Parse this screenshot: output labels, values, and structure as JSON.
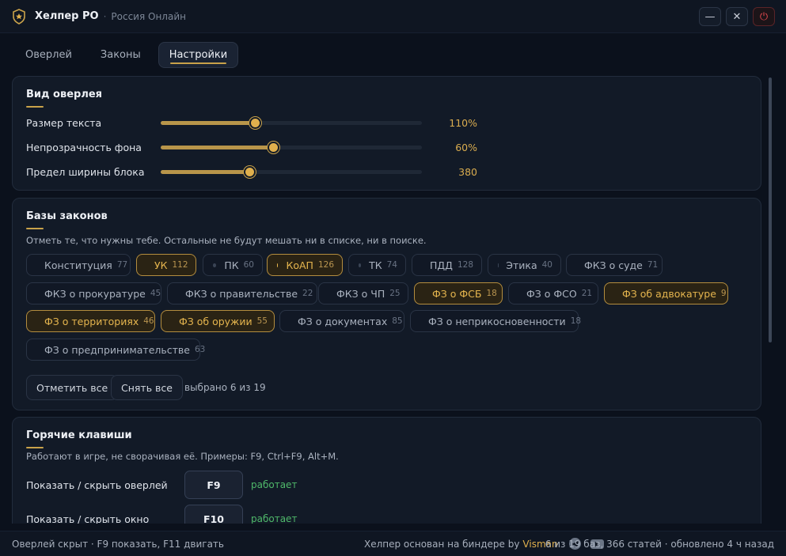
{
  "app": {
    "name": "Хелпер РО",
    "subtitle": "Россия Онлайн",
    "separator": "·"
  },
  "window_buttons": [
    {
      "name": "minimize-button",
      "glyph": "—"
    },
    {
      "name": "close-button",
      "glyph": "✕"
    },
    {
      "name": "power-button",
      "glyph": "⏻"
    }
  ],
  "tabs": [
    {
      "label": "Оверлей",
      "active": false
    },
    {
      "label": "Законы",
      "active": false
    },
    {
      "label": "Настройки",
      "active": true
    }
  ],
  "overlay_view": {
    "title": "Вид оверлея",
    "sliders": [
      {
        "label": "Размер текста",
        "value": "110%",
        "level": 0.36
      },
      {
        "label": "Непрозрачность фона",
        "value": "60%",
        "level": 0.43
      },
      {
        "label": "Предел ширины блока",
        "value": "380",
        "level": 0.34
      }
    ]
  },
  "law_bases": {
    "title": "Базы законов",
    "hint": "Отметь те, что нужны тебе. Остальные не будут мешать ни в списке, ни в поиске.",
    "chips": [
      {
        "label": "Конституция",
        "count": "77",
        "selected": false
      },
      {
        "label": "УК",
        "count": "112",
        "selected": true
      },
      {
        "label": "ПК",
        "count": "60",
        "selected": false
      },
      {
        "label": "КоАП",
        "count": "126",
        "selected": true
      },
      {
        "label": "ТК",
        "count": "74",
        "selected": false
      },
      {
        "label": "ПДД",
        "count": "128",
        "selected": false
      },
      {
        "label": "Этика",
        "count": "40",
        "selected": false
      },
      {
        "label": "ФКЗ о суде",
        "count": "71",
        "selected": false
      },
      {
        "label": "ФКЗ о прокуратуре",
        "count": "45",
        "selected": false
      },
      {
        "label": "ФКЗ о правительстве",
        "count": "22",
        "selected": false
      },
      {
        "label": "ФКЗ о ЧП",
        "count": "25",
        "selected": false
      },
      {
        "label": "ФЗ о ФСБ",
        "count": "18",
        "selected": true
      },
      {
        "label": "ФЗ о ФСО",
        "count": "21",
        "selected": false
      },
      {
        "label": "ФЗ об адвокатуре",
        "count": "9",
        "selected": true
      },
      {
        "label": "ФЗ о территориях",
        "count": "46",
        "selected": true
      },
      {
        "label": "ФЗ об оружии",
        "count": "55",
        "selected": true
      },
      {
        "label": "ФЗ о документах",
        "count": "85",
        "selected": false
      },
      {
        "label": "ФЗ о неприкосновенности",
        "count": "18",
        "selected": false
      },
      {
        "label": "ФЗ о предпринимательстве",
        "count": "63",
        "selected": false
      }
    ],
    "select_all": "Отметить все",
    "clear_all": "Снять все",
    "selected_info": "выбрано 6 из 19"
  },
  "hotkeys": {
    "title": "Горячие клавиши",
    "hint": "Работают в игре, не сворачивая её. Примеры: F9, Ctrl+F9, Alt+M.",
    "rows": [
      {
        "label": "Показать / скрыть оверлей",
        "key": "F9",
        "status": "работает"
      },
      {
        "label": "Показать / скрыть окно",
        "key": "F10",
        "status": "работает"
      }
    ]
  },
  "footer": {
    "left": "Оверлей скрыт · F9 показать, F11 двигать",
    "mid": "Хелпер основан на биндере by",
    "brand": "Visman",
    "right": "6 из 19 баз, 366 статей · обновлено 4 ч назад"
  },
  "colors": {
    "accent": "#c9a24a",
    "ok": "#4fb86a",
    "danger": "#e0484e",
    "bg": "#0b111c"
  },
  "icons": [
    "shield-star-icon",
    "minimize-icon",
    "close-icon",
    "power-icon",
    "telegram-icon",
    "youtube-icon"
  ]
}
